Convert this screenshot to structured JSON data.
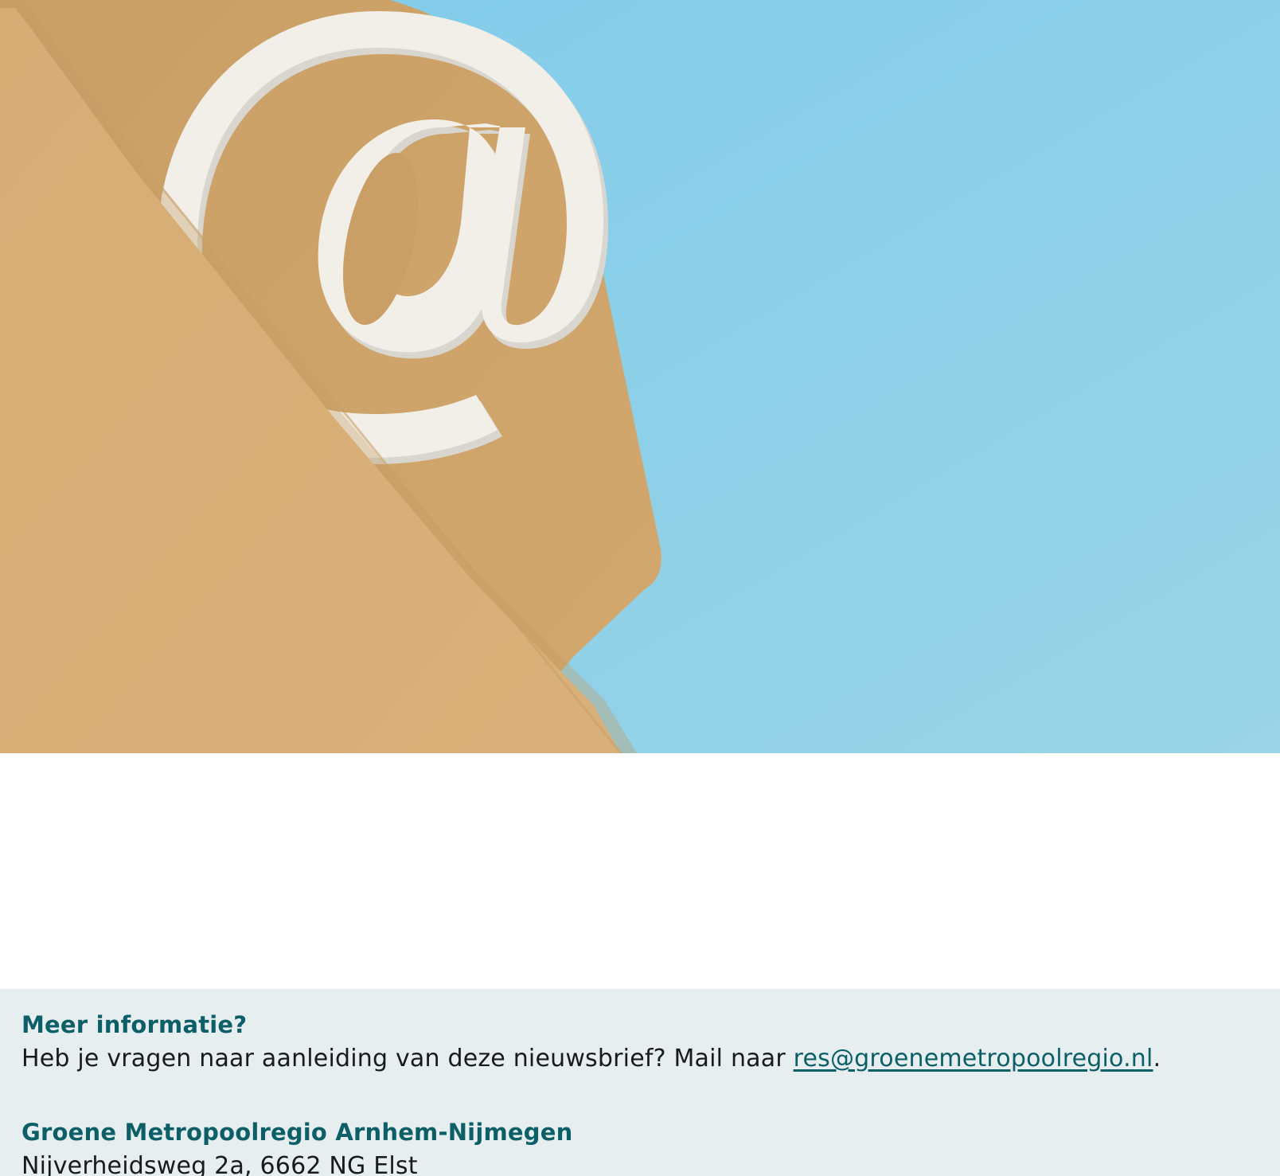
{
  "hero": {
    "image_label": "@",
    "colors": {
      "sky": "#8bd0e8",
      "envelope": "#d4aa70",
      "envelope_shadow": "#c89c62",
      "symbol": "#f2efe8"
    }
  },
  "info": {
    "title": "Meer informatie?",
    "text_prefix": "Heb je vragen naar aanleiding van deze nieuwsbrief? Mail naar ",
    "email": "res@groenemetropoolregio.nl",
    "text_suffix": "."
  },
  "organization": {
    "name": "Groene Metropoolregio Arnhem-Nijmegen",
    "address": "Nijverheidsweg 2a, 6662 NG Elst"
  },
  "colors": {
    "accent": "#0c5f67",
    "info_background": "#e6eef0",
    "body_text": "#1a1a1a"
  }
}
